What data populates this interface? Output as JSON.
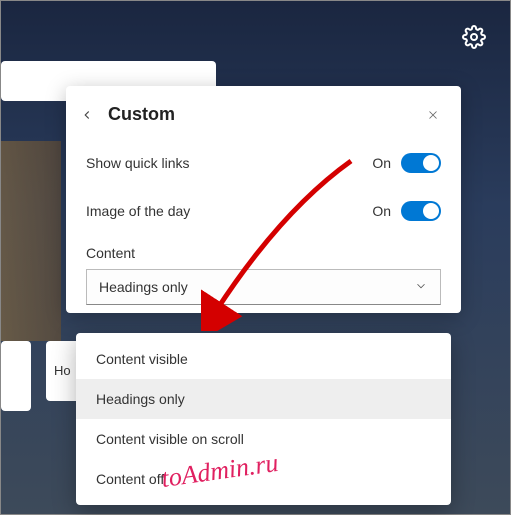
{
  "header": {
    "title": "Custom"
  },
  "settings": {
    "quick_links": {
      "label": "Show quick links",
      "state": "On"
    },
    "image_of_day": {
      "label": "Image of the day",
      "state": "On"
    },
    "content_label": "Content",
    "content_selected": "Headings only",
    "content_options": {
      "0": "Content visible",
      "1": "Headings only",
      "2": "Content visible on scroll",
      "3": "Content off"
    }
  },
  "cards": {
    "ho": "Ho"
  },
  "colors": {
    "accent": "#0078d4",
    "arrow": "#d40000",
    "watermark": "#e02060"
  },
  "watermark": "toAdmin.ru"
}
